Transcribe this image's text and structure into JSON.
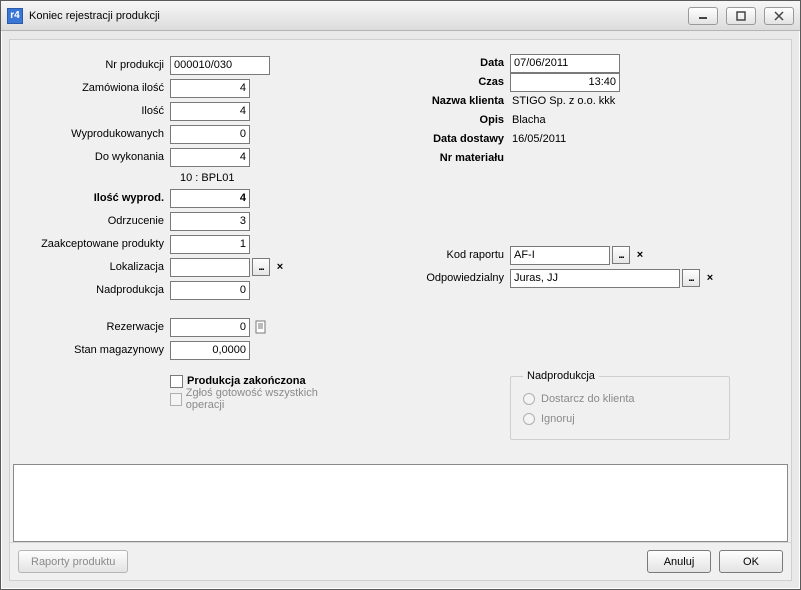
{
  "window": {
    "title": "Koniec rejestracji produkcji",
    "app_icon_text": "r4"
  },
  "left": {
    "nr_produkcji_label": "Nr produkcji",
    "nr_produkcji": "000010/030",
    "zamowiona_label": "Zamówiona ilość",
    "zamowiona": "4",
    "ilosc_label": "Ilość",
    "ilosc": "4",
    "wyprodukowanych_label": "Wyprodukowanych",
    "wyprodukowanych": "0",
    "do_wykonania_label": "Do wykonania",
    "do_wykonania": "4",
    "operation_note": "10 :    BPL01",
    "ilosc_wyprod_label": "Ilość wyprod.",
    "ilosc_wyprod": "4",
    "odrzucenie_label": "Odrzucenie",
    "odrzucenie": "3",
    "zaakceptowane_label": "Zaakceptowane produkty",
    "zaakceptowane": "1",
    "lokalizacja_label": "Lokalizacja",
    "lokalizacja": "",
    "nadprodukcja_label": "Nadprodukcja",
    "nadprodukcja": "0",
    "rezerwacje_label": "Rezerwacje",
    "rezerwacje": "0",
    "stan_label": "Stan magazynowy",
    "stan": "0,0000",
    "cb_zakonczona_label": "Produkcja zakończona",
    "cb_zglos_label": "Zgłoś gotowość wszystkich operacji"
  },
  "right": {
    "data_label": "Data",
    "data": "07/06/2011",
    "czas_label": "Czas",
    "czas": "13:40",
    "nazwa_klienta_label": "Nazwa klienta",
    "nazwa_klienta": "STIGO Sp. z o.o. kkk",
    "opis_label": "Opis",
    "opis": "Blacha",
    "data_dostawy_label": "Data dostawy",
    "data_dostawy": "16/05/2011",
    "nr_materialu_label": "Nr materiału",
    "nr_materialu": "",
    "kod_raportu_label": "Kod raportu",
    "kod_raportu": "AF-I",
    "odpowiedzialny_label": "Odpowiedzialny",
    "odpowiedzialny": "Juras, JJ",
    "group_nadprodukcja_label": "Nadprodukcja",
    "radio_dostarcz_label": "Dostarcz do klienta",
    "radio_ignoruj_label": "Ignoruj"
  },
  "buttons": {
    "raporty": "Raporty produktu",
    "anuluj": "Anuluj",
    "ok": "OK"
  },
  "icons": {
    "ellipsis": "...",
    "close": "×"
  }
}
